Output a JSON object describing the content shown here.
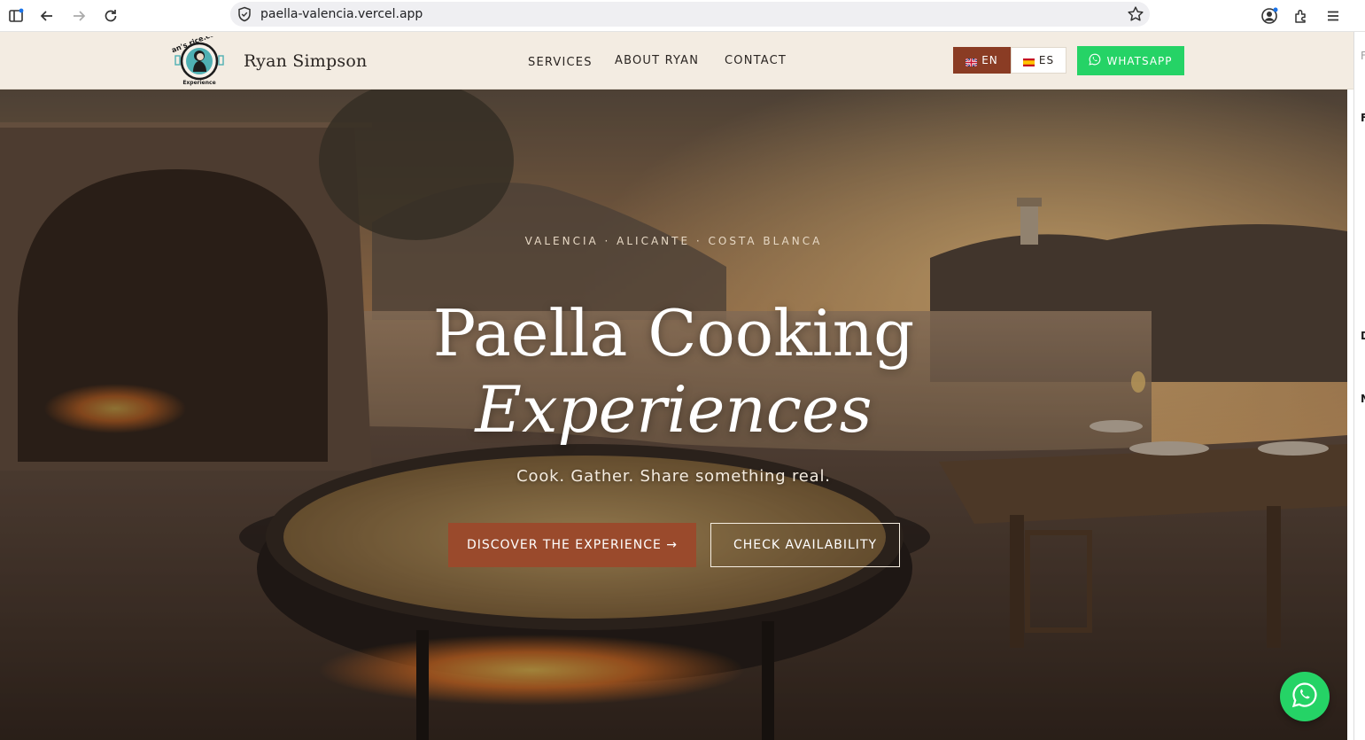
{
  "browser": {
    "url": "paella-valencia.vercel.app",
    "icons": [
      "sidebar-icon",
      "back-icon",
      "forward-icon",
      "reload-icon",
      "shield-icon",
      "star-icon",
      "account-icon",
      "extensions-icon",
      "menu-icon"
    ]
  },
  "header": {
    "brand": "Ryan Simpson",
    "logo_text": "Ryan's rice.com",
    "logo_subtext": "Experience",
    "nav": [
      {
        "label": "SERVICES"
      },
      {
        "label": "ABOUT RYAN"
      },
      {
        "label": "CONTACT"
      }
    ],
    "lang_en": "EN",
    "lang_es": "ES",
    "whatsapp_label": "WHATSAPP"
  },
  "hero": {
    "eyebrow": "VALENCIA · ALICANTE · COSTA BLANCA",
    "title_line1": "Paella Cooking",
    "title_line2": "Experiences",
    "tagline": "Cook. Gather. Share something real.",
    "primary_cta": "DISCOVER THE EXPERIENCE →",
    "secondary_cta": "CHECK AVAILABILITY"
  },
  "right_edge": {
    "letters": [
      "F",
      "F",
      "D",
      "N"
    ]
  },
  "colors": {
    "header_bg": "#f3ece2",
    "accent": "#8a3c24",
    "whatsapp": "#25d366",
    "cta_primary": "#9a4a2c"
  }
}
